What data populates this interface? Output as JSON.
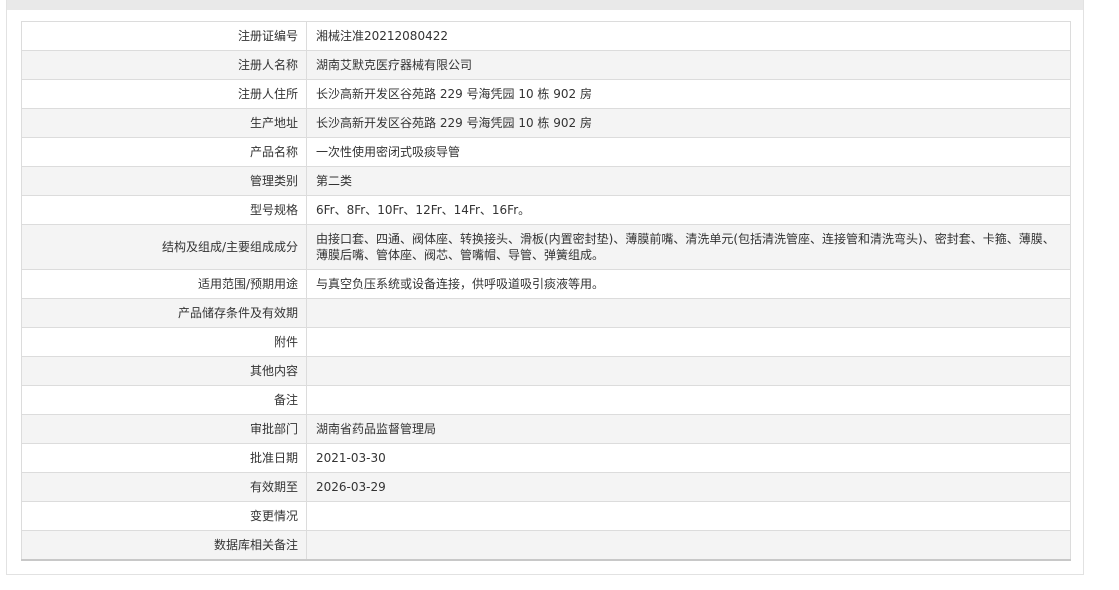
{
  "rows": [
    {
      "label": "注册证编号",
      "value": "湘械注准20212080422"
    },
    {
      "label": "注册人名称",
      "value": "湖南艾默克医疗器械有限公司"
    },
    {
      "label": "注册人住所",
      "value": "长沙高新开发区谷苑路 229 号海凭园 10 栋 902 房"
    },
    {
      "label": "生产地址",
      "value": "长沙高新开发区谷苑路 229 号海凭园 10 栋 902 房"
    },
    {
      "label": "产品名称",
      "value": "一次性使用密闭式吸痰导管"
    },
    {
      "label": "管理类别",
      "value": "第二类"
    },
    {
      "label": "型号规格",
      "value": "6Fr、8Fr、10Fr、12Fr、14Fr、16Fr。"
    },
    {
      "label": "结构及组成/主要组成成分",
      "value": "由接口套、四通、阀体座、转换接头、滑板(内置密封垫)、薄膜前嘴、清洗单元(包括清洗管座、连接管和清洗弯头)、密封套、卡箍、薄膜、薄膜后嘴、管体座、阀芯、管嘴帽、导管、弹簧组成。"
    },
    {
      "label": "适用范围/预期用途",
      "value": "与真空负压系统或设备连接，供呼吸道吸引痰液等用。"
    },
    {
      "label": "产品储存条件及有效期",
      "value": ""
    },
    {
      "label": "附件",
      "value": ""
    },
    {
      "label": "其他内容",
      "value": ""
    },
    {
      "label": "备注",
      "value": ""
    },
    {
      "label": "审批部门",
      "value": "湖南省药品监督管理局"
    },
    {
      "label": "批准日期",
      "value": "2021-03-30"
    },
    {
      "label": "有效期至",
      "value": "2026-03-29"
    },
    {
      "label": "变更情况",
      "value": ""
    },
    {
      "label": "数据库相关备注",
      "value": ""
    }
  ]
}
